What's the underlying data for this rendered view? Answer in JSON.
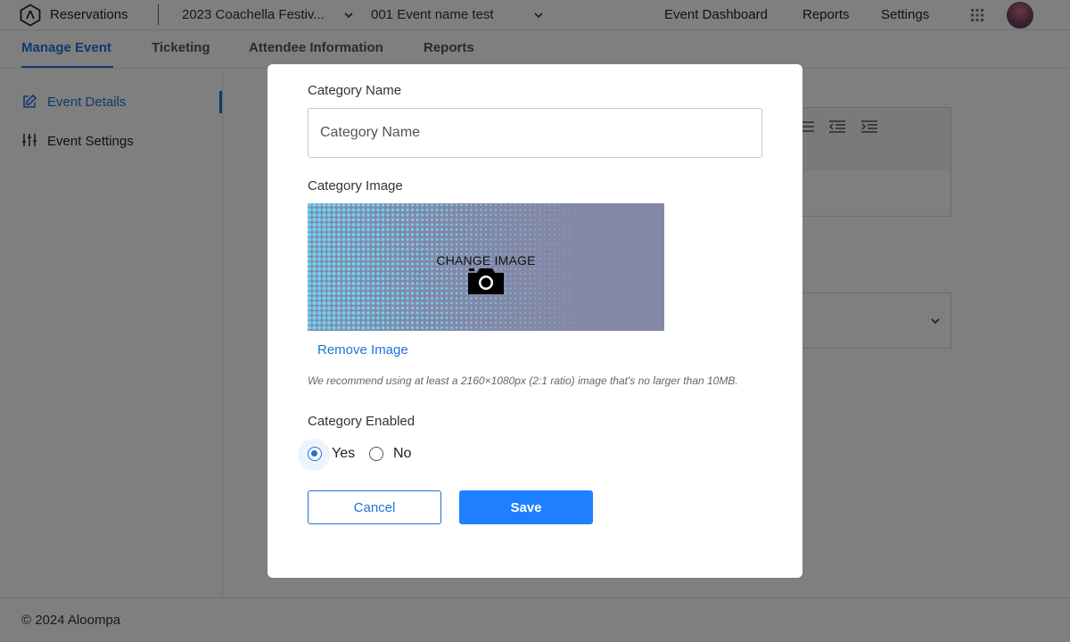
{
  "topbar": {
    "app_name": "Reservations",
    "event_select": "2023 Coachella Festiv...",
    "sub_select": "001 Event name test",
    "links": [
      "Event Dashboard",
      "Reports",
      "Settings"
    ]
  },
  "tabs": [
    {
      "label": "Manage Event",
      "active": true
    },
    {
      "label": "Ticketing",
      "active": false
    },
    {
      "label": "Attendee Information",
      "active": false
    },
    {
      "label": "Reports",
      "active": false
    }
  ],
  "sidebar": {
    "items": [
      {
        "label": "Event Details",
        "icon": "edit-icon",
        "active": true
      },
      {
        "label": "Event Settings",
        "icon": "sliders-icon",
        "active": false
      }
    ]
  },
  "footer": {
    "text": "© 2024 Aloompa"
  },
  "modal": {
    "name_label": "Category Name",
    "name_placeholder": "Category Name",
    "name_value": "",
    "image_label": "Category Image",
    "change_image_label": "CHANGE IMAGE",
    "remove_image_label": "Remove Image",
    "image_hint": "We recommend using at least a 2160×1080px (2:1 ratio) image that's no larger than 10MB.",
    "enabled_label": "Category Enabled",
    "enabled_options": [
      {
        "label": "Yes",
        "checked": true
      },
      {
        "label": "No",
        "checked": false
      }
    ],
    "cancel_label": "Cancel",
    "save_label": "Save"
  },
  "colors": {
    "accent": "#1e73d8",
    "primary_button": "#1e80ff",
    "overlay": "rgba(0,0,0,0.5)"
  }
}
